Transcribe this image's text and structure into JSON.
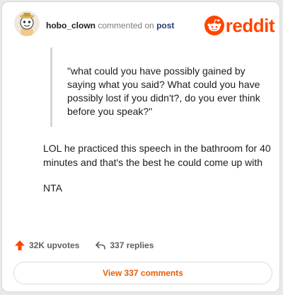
{
  "header": {
    "username": "hobo_clown",
    "verb": "commented on",
    "target": "post",
    "brand_name": "reddit"
  },
  "icons": {
    "avatar": "snoo-avatar-icon",
    "brand": "reddit-logo-icon",
    "upvote": "upvote-arrow-icon",
    "reply": "reply-arrow-icon"
  },
  "colors": {
    "brand": "#ff4500",
    "upvote": "#ff4500",
    "button_text": "#e85d04",
    "quote_bar": "#d6d6d6"
  },
  "comment": {
    "quote": "\"what could you have possibly gained by saying what you said? What could you have possibly lost if you didn't?, do you ever think before you speak?\"",
    "paragraphs": [
      "LOL he practiced this speech in the bathroom for 40 minutes and that's the best he could come up with",
      "NTA"
    ]
  },
  "stats": {
    "upvotes": "32K upvotes",
    "replies": "337 replies"
  },
  "view_button": {
    "label": "View 337 comments"
  }
}
